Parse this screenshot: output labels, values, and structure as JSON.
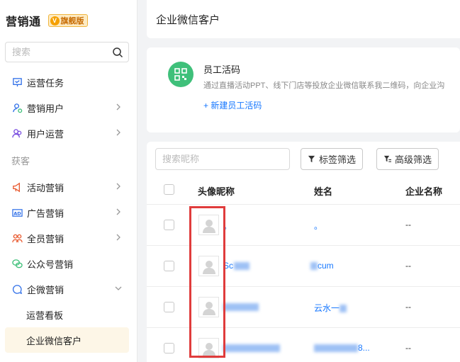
{
  "sidebar": {
    "brand": "营销通",
    "badge": "旗舰版",
    "search_placeholder": "搜索",
    "items": [
      {
        "label": "运营任务",
        "icon": "task-flag-icon"
      },
      {
        "label": "营销用户",
        "icon": "marketing-user-icon"
      },
      {
        "label": "用户运营",
        "icon": "user-ops-icon"
      }
    ],
    "section": "获客",
    "acquire_items": [
      {
        "label": "活动营销",
        "icon": "megaphone-icon"
      },
      {
        "label": "广告营销",
        "icon": "ad-icon"
      },
      {
        "label": "全员营销",
        "icon": "staff-marketing-icon"
      },
      {
        "label": "公众号营销",
        "icon": "wechat-icon"
      },
      {
        "label": "企微营销",
        "icon": "wecom-chat-icon"
      }
    ],
    "sub_items": [
      "运营看板",
      "企业微信客户"
    ]
  },
  "header": {
    "title": "企业微信客户"
  },
  "promo": {
    "title": "员工活码",
    "description": "通过直播活动PPT、线下门店等投放企业微信联系我二维码，向企业沟",
    "link": "+ 新建员工活码"
  },
  "table": {
    "search_placeholder": "搜索昵称",
    "tag_filter": "标签筛选",
    "advanced_filter": "高级筛选",
    "columns": [
      "头像昵称",
      "姓名",
      "企业名称"
    ],
    "rows": [
      {
        "nickname": "。",
        "name": "。",
        "company": "--"
      },
      {
        "nickname": "Sc",
        "name": "cum",
        "company": "--"
      },
      {
        "nickname": "",
        "name": "云水一",
        "company": "--"
      },
      {
        "nickname": "",
        "name": "8...",
        "company": "--"
      }
    ]
  },
  "colors": {
    "accent": "#1677ff",
    "active_bg": "#fdf6e7",
    "highlight": "#e03c3c",
    "promo_icon": "#3fc07a"
  }
}
